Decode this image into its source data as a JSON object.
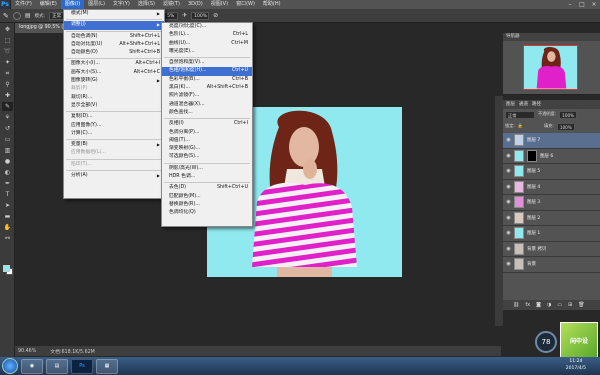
{
  "menubar": {
    "logo": "Ps",
    "items": [
      "文件(F)",
      "编辑(E)",
      "图像(I)",
      "图层(L)",
      "文字(Y)",
      "选择(S)",
      "滤镜(T)",
      "3D(D)",
      "视图(V)",
      "窗口(W)",
      "帮助(H)"
    ],
    "active_index": 2,
    "window_buttons": [
      "–",
      "□",
      "×"
    ]
  },
  "options": {
    "mode_value": "正常",
    "opacity_value": "100%",
    "flow_value": "5%",
    "extra_value": "100%"
  },
  "document": {
    "tab_label": "longjpg @ 90.5% (图层 7, RGB/8)",
    "zoom": "90.46%",
    "doc_size": "文档:618.1K/5.62M"
  },
  "image_menu": {
    "items": [
      {
        "label": "模式(M)",
        "shortcut": "",
        "submenu": true,
        "disabled": false,
        "highlight": false
      },
      {
        "sep": true
      },
      {
        "label": "调整(J)",
        "shortcut": "",
        "submenu": true,
        "disabled": false,
        "highlight": true
      },
      {
        "sep": true
      },
      {
        "label": "自动色调(N)",
        "shortcut": "Shift+Ctrl+L",
        "submenu": false,
        "disabled": false,
        "highlight": false
      },
      {
        "label": "自动对比度(U)",
        "shortcut": "Alt+Shift+Ctrl+L",
        "submenu": false,
        "disabled": false,
        "highlight": false
      },
      {
        "label": "自动颜色(O)",
        "shortcut": "Shift+Ctrl+B",
        "submenu": false,
        "disabled": false,
        "highlight": false
      },
      {
        "sep": true
      },
      {
        "label": "图像大小(I)...",
        "shortcut": "Alt+Ctrl+I",
        "submenu": false,
        "disabled": false,
        "highlight": false
      },
      {
        "label": "画布大小(S)...",
        "shortcut": "Alt+Ctrl+C",
        "submenu": false,
        "disabled": false,
        "highlight": false
      },
      {
        "label": "图像旋转(G)",
        "shortcut": "",
        "submenu": true,
        "disabled": false,
        "highlight": false
      },
      {
        "label": "裁剪(P)",
        "shortcut": "",
        "submenu": false,
        "disabled": true,
        "highlight": false
      },
      {
        "label": "裁切(R)...",
        "shortcut": "",
        "submenu": false,
        "disabled": false,
        "highlight": false
      },
      {
        "label": "显示全部(V)",
        "shortcut": "",
        "submenu": false,
        "disabled": false,
        "highlight": false
      },
      {
        "sep": true
      },
      {
        "label": "复制(D)...",
        "shortcut": "",
        "submenu": false,
        "disabled": false,
        "highlight": false
      },
      {
        "label": "应用图像(Y)...",
        "shortcut": "",
        "submenu": false,
        "disabled": false,
        "highlight": false
      },
      {
        "label": "计算(C)...",
        "shortcut": "",
        "submenu": false,
        "disabled": false,
        "highlight": false
      },
      {
        "sep": true
      },
      {
        "label": "变量(B)",
        "shortcut": "",
        "submenu": true,
        "disabled": false,
        "highlight": false
      },
      {
        "label": "应用数据组(L)...",
        "shortcut": "",
        "submenu": false,
        "disabled": true,
        "highlight": false
      },
      {
        "sep": true
      },
      {
        "label": "陷印(T)...",
        "shortcut": "",
        "submenu": false,
        "disabled": true,
        "highlight": false
      },
      {
        "sep": true
      },
      {
        "label": "分析(A)",
        "shortcut": "",
        "submenu": true,
        "disabled": false,
        "highlight": false
      }
    ]
  },
  "adjust_menu": {
    "items": [
      {
        "label": "亮度/对比度(C)...",
        "shortcut": "",
        "highlight": false
      },
      {
        "label": "色阶(L)...",
        "shortcut": "Ctrl+L",
        "highlight": false
      },
      {
        "label": "曲线(U)...",
        "shortcut": "Ctrl+M",
        "highlight": false
      },
      {
        "label": "曝光度(E)...",
        "shortcut": "",
        "highlight": false
      },
      {
        "sep": true
      },
      {
        "label": "自然饱和度(V)...",
        "shortcut": "",
        "highlight": false
      },
      {
        "label": "色相/饱和度(H)...",
        "shortcut": "Ctrl+U",
        "highlight": true
      },
      {
        "label": "色彩平衡(B)...",
        "shortcut": "Ctrl+B",
        "highlight": false
      },
      {
        "label": "黑白(K)...",
        "shortcut": "Alt+Shift+Ctrl+B",
        "highlight": false
      },
      {
        "label": "照片滤镜(F)...",
        "shortcut": "",
        "highlight": false
      },
      {
        "label": "通道混合器(X)...",
        "shortcut": "",
        "highlight": false
      },
      {
        "label": "颜色查找...",
        "shortcut": "",
        "highlight": false
      },
      {
        "sep": true
      },
      {
        "label": "反相(I)",
        "shortcut": "Ctrl+I",
        "highlight": false
      },
      {
        "label": "色调分离(P)...",
        "shortcut": "",
        "highlight": false
      },
      {
        "label": "阈值(T)...",
        "shortcut": "",
        "highlight": false
      },
      {
        "label": "渐变映射(G)...",
        "shortcut": "",
        "highlight": false
      },
      {
        "label": "可选颜色(S)...",
        "shortcut": "",
        "highlight": false
      },
      {
        "sep": true
      },
      {
        "label": "阴影/高光(W)...",
        "shortcut": "",
        "highlight": false
      },
      {
        "label": "HDR 色调...",
        "shortcut": "",
        "highlight": false
      },
      {
        "sep": true
      },
      {
        "label": "去色(D)",
        "shortcut": "Shift+Ctrl+U",
        "highlight": false
      },
      {
        "label": "匹配颜色(M)...",
        "shortcut": "",
        "highlight": false
      },
      {
        "label": "替换颜色(R)...",
        "shortcut": "",
        "highlight": false
      },
      {
        "label": "色调均化(Q)",
        "shortcut": "",
        "highlight": false
      }
    ]
  },
  "navigator": {
    "tabs": "导航器"
  },
  "layers": {
    "tabs": [
      "图层",
      "通道",
      "路径"
    ],
    "blend_mode": "正常",
    "opacity_label": "不透明度:",
    "opacity_value": "100%",
    "lock_label": "锁定:",
    "fill_label": "填充:",
    "fill_value": "100%",
    "rows": [
      {
        "name": "图层 7",
        "selected": true,
        "mask": false,
        "thumb": "#c0d0e8"
      },
      {
        "name": "图层 6",
        "selected": false,
        "mask": true,
        "thumb": "#8fe9ee"
      },
      {
        "name": "图层 5",
        "selected": false,
        "mask": false,
        "thumb": "#8fe9ee"
      },
      {
        "name": "图层 4",
        "selected": false,
        "mask": false,
        "thumb": "#e8b8e0"
      },
      {
        "name": "图层 3",
        "selected": false,
        "mask": false,
        "thumb": "#e090d8"
      },
      {
        "name": "图层 2",
        "selected": false,
        "mask": false,
        "thumb": "#d8c8c0"
      },
      {
        "name": "图层 1",
        "selected": false,
        "mask": false,
        "thumb": "#8fe9ee"
      },
      {
        "name": "背景 拷贝",
        "selected": false,
        "mask": false,
        "thumb": "#c8c0b8"
      },
      {
        "name": "背景",
        "selected": false,
        "mask": false,
        "thumb": "#c8c0b8"
      }
    ]
  },
  "widget": {
    "speed": "78"
  },
  "corner_logo": {
    "text": "闲中设"
  },
  "taskbar": {
    "time": "11:24",
    "date": "2017/4/5",
    "apps": [
      "",
      "Ps",
      ""
    ]
  }
}
